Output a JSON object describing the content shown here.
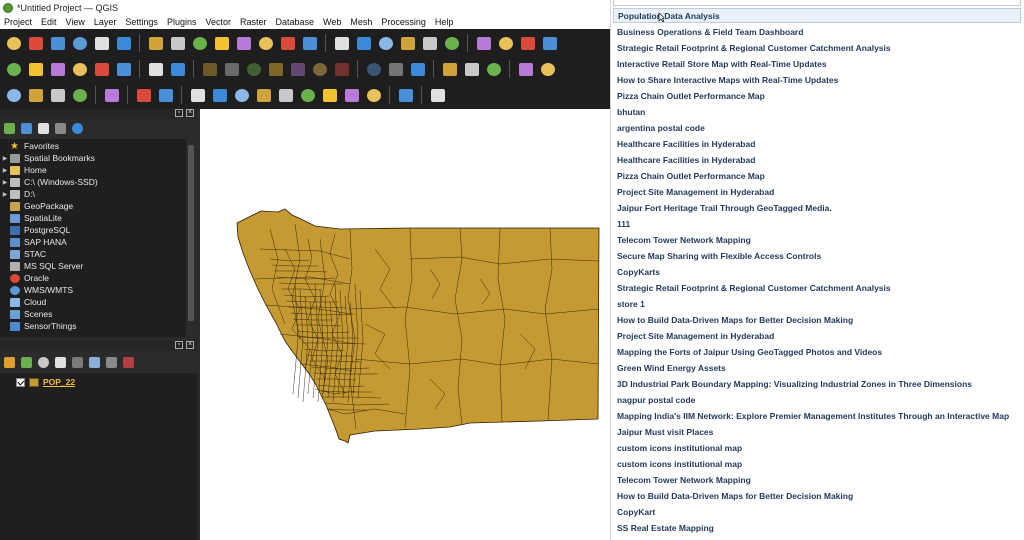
{
  "window": {
    "title": "*Untitled Project — QGIS"
  },
  "menu": [
    {
      "label": "Project",
      "u": "P",
      "rest": "roject"
    },
    {
      "label": "Edit",
      "u": "E",
      "rest": "dit"
    },
    {
      "label": "View",
      "u": "V",
      "rest": "iew"
    },
    {
      "label": "Layer",
      "u": "L",
      "rest": "ayer"
    },
    {
      "label": "Settings",
      "u": "S",
      "rest": "ettings"
    },
    {
      "label": "Plugins",
      "u": "P",
      "rest": "lugins"
    },
    {
      "label": "Vector",
      "u": "V",
      "rest": "ector"
    },
    {
      "label": "Raster",
      "u": "R",
      "rest": "aster"
    },
    {
      "label": "Database",
      "u": "D",
      "rest": "atabase"
    },
    {
      "label": "Web",
      "u": "W",
      "rest": "eb"
    },
    {
      "label": "Mesh",
      "u": "M",
      "rest": "esh"
    },
    {
      "label": "Processing",
      "u": "o",
      "rest": "Pr|cessing"
    },
    {
      "label": "Help",
      "u": "H",
      "rest": "elp"
    }
  ],
  "browser": {
    "items": [
      {
        "label": "Favorites",
        "icon": "star-icon",
        "color": "#f2c230",
        "arrow": ""
      },
      {
        "label": "Spatial Bookmarks",
        "icon": "bookmark-icon",
        "color": "#9a9a9a",
        "arrow": "▶"
      },
      {
        "label": "Home",
        "icon": "folder-icon",
        "color": "#e8c15a",
        "arrow": "▶"
      },
      {
        "label": "C:\\ (Windows-SSD)",
        "icon": "drive-icon",
        "color": "#bdbdbd",
        "arrow": "▶"
      },
      {
        "label": "D:\\",
        "icon": "drive-icon",
        "color": "#bdbdbd",
        "arrow": "▶"
      },
      {
        "label": "GeoPackage",
        "icon": "geopackage-icon",
        "color": "#c9a24a",
        "arrow": ""
      },
      {
        "label": "SpatiaLite",
        "icon": "spatialite-icon",
        "color": "#6a9ad8",
        "arrow": ""
      },
      {
        "label": "PostgreSQL",
        "icon": "postgresql-icon",
        "color": "#3b6fb0",
        "arrow": ""
      },
      {
        "label": "SAP HANA",
        "icon": "sap-hana-icon",
        "color": "#5a8fd0",
        "arrow": ""
      },
      {
        "label": "STAC",
        "icon": "stac-icon",
        "color": "#7aa6d8",
        "arrow": ""
      },
      {
        "label": "MS SQL Server",
        "icon": "mssql-icon",
        "color": "#b0b0b0",
        "arrow": ""
      },
      {
        "label": "Oracle",
        "icon": "oracle-icon",
        "color": "#d94a3a",
        "arrow": ""
      },
      {
        "label": "WMS/WMTS",
        "icon": "globe-icon",
        "color": "#5a9ad8",
        "arrow": ""
      },
      {
        "label": "Cloud",
        "icon": "cloud-icon",
        "color": "#8ab8e8",
        "arrow": ""
      },
      {
        "label": "Scenes",
        "icon": "scenes-icon",
        "color": "#6aa0d8",
        "arrow": ""
      },
      {
        "label": "SensorThings",
        "icon": "sensor-icon",
        "color": "#4a8ad0",
        "arrow": ""
      }
    ]
  },
  "layers": {
    "items": [
      {
        "name": "POP_22",
        "fill": "#c59a32"
      }
    ]
  },
  "dropdown": {
    "items": [
      "Population Data Analysis",
      "Business Operations & Field Team Dashboard",
      "Strategic Retail Footprint & Regional Customer Catchment Analysis",
      "Interactive Retail Store Map with Real-Time Updates",
      "How to Share Interactive Maps with Real-Time Updates",
      "Pizza Chain Outlet Performance Map",
      "bhutan",
      "argentina postal code",
      "Healthcare Facilities in Hyderabad",
      "Healthcare Facilities in Hyderabad",
      "Pizza Chain Outlet Performance Map",
      "Project Site Management in Hyderabad",
      "Jaipur Fort Heritage Trail Through GeoTagged Media.",
      "111",
      "Telecom Tower Network Mapping",
      "Secure Map Sharing with Flexible Access Controls",
      "CopyKarts",
      "Strategic Retail Footprint & Regional Customer Catchment Analysis",
      "store 1",
      "How to Build Data-Driven Maps for Better Decision Making",
      "Project Site Management in Hyderabad",
      "Mapping the Forts of Jaipur Using GeoTagged Photos and Videos",
      "Green Wind Energy Assets",
      "3D Industrial Park Boundary Mapping: Visualizing Industrial Zones in Three Dimensions",
      "nagpur postal code",
      "Mapping India's IIM Network: Explore Premier Management Institutes Through an Interactive Map",
      "Jaipur Must visit Places",
      "custom icons institutional map",
      "custom icons institutional map",
      "Telecom Tower Network Mapping",
      "How to Build Data-Driven Maps for Better Decision Making",
      "CopyKart",
      "SS Real Estate Mapping"
    ],
    "selected_index": 0
  },
  "colors": {
    "polygon_fill": "#c59a32",
    "polygon_stroke": "#2a1e08",
    "dark_panel": "#1f1f1f",
    "dropdown_text": "#1f3a5a"
  }
}
